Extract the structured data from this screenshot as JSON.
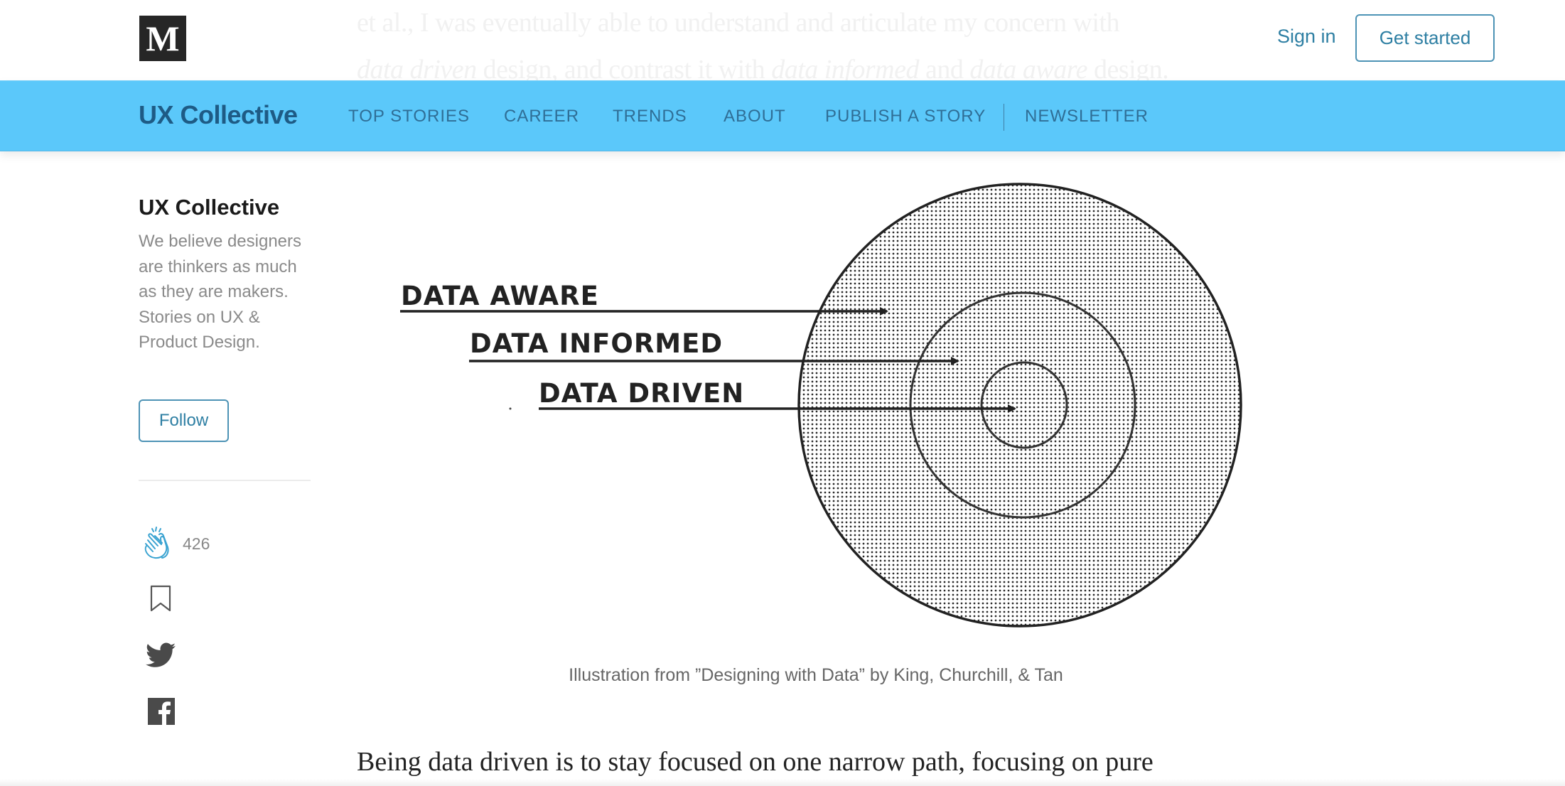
{
  "background_article": {
    "line1": "et al., I was eventually able to understand and articulate my concern with",
    "line2_parts": [
      "data driven",
      " design, and contrast it with ",
      "data informed",
      " and ",
      "data aware",
      " design."
    ]
  },
  "topbar": {
    "logo_letter": "M",
    "signin_label": "Sign in",
    "get_started_label": "Get started"
  },
  "navbar": {
    "brand": "UX Collective",
    "items": [
      {
        "label": "TOP STORIES"
      },
      {
        "label": "CAREER"
      },
      {
        "label": "TRENDS"
      },
      {
        "label": "ABOUT"
      },
      {
        "label": "PUBLISH A STORY"
      },
      {
        "label": "NEWSLETTER"
      }
    ],
    "accent_color": "#5bc8fa"
  },
  "sidebar": {
    "publication_name": "UX Collective",
    "description": "We believe designers are thinkers as much as they are makers. Stories on UX & Product Design.",
    "follow_label": "Follow",
    "clap_count": "426",
    "icons": [
      "clap-icon",
      "bookmark-icon",
      "twitter-icon",
      "facebook-icon"
    ]
  },
  "figure": {
    "labels": [
      "DATA AWARE",
      "DATA INFORMED",
      "DATA DRIVEN"
    ],
    "caption": "Illustration from ”Designing with Data” by King, Churchill, & Tan"
  },
  "article": {
    "paragraph_start": "Being data driven is to stay focused on one narrow path, focusing on pure"
  }
}
